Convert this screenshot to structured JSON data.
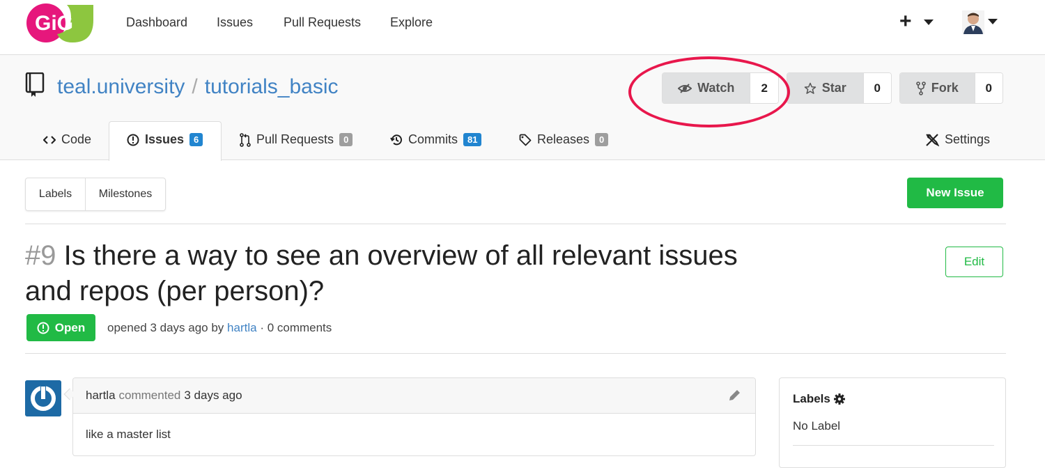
{
  "nav": {
    "items": [
      "Dashboard",
      "Issues",
      "Pull Requests",
      "Explore"
    ],
    "plus_label": "+"
  },
  "repo": {
    "owner": "teal.university",
    "separator": "/",
    "name": "tutorials_basic"
  },
  "actions": {
    "watch": {
      "label": "Watch",
      "count": "2"
    },
    "star": {
      "label": "Star",
      "count": "0"
    },
    "fork": {
      "label": "Fork",
      "count": "0"
    }
  },
  "tabs": {
    "code": {
      "label": "Code"
    },
    "issues": {
      "label": "Issues",
      "count": "6"
    },
    "pulls": {
      "label": "Pull Requests",
      "count": "0"
    },
    "commits": {
      "label": "Commits",
      "count": "81"
    },
    "releases": {
      "label": "Releases",
      "count": "0"
    },
    "settings": {
      "label": "Settings"
    }
  },
  "filters": {
    "labels": "Labels",
    "milestones": "Milestones",
    "new_issue": "New Issue"
  },
  "issue": {
    "number": "#9",
    "title": "Is there a way to see an overview of all relevant issues and repos (per person)?",
    "edit_label": "Edit",
    "status": "Open",
    "opened_text": "opened 3 days ago by",
    "author": "hartla",
    "comments_text": "· 0 comments"
  },
  "comment": {
    "author": "hartla",
    "action": "commented",
    "time": "3 days ago",
    "body": "like a master list"
  },
  "sidebar": {
    "labels_title": "Labels",
    "labels_value": "No Label"
  },
  "colors": {
    "accent_link": "#4183c4",
    "success_green": "#21ba45",
    "badge_blue": "#2185d0",
    "highlight_red": "#e8174c"
  }
}
